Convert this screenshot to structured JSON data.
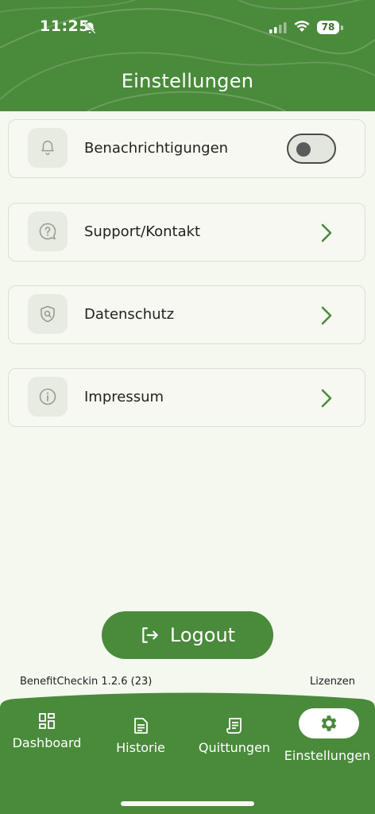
{
  "status_bar": {
    "time": "11:25",
    "battery": "78"
  },
  "header": {
    "title": "Einstellungen"
  },
  "settings": {
    "notifications": {
      "label": "Benachrichtigungen",
      "enabled": false
    },
    "support": {
      "label": "Support/Kontakt"
    },
    "privacy": {
      "label": "Datenschutz"
    },
    "imprint": {
      "label": "Impressum"
    }
  },
  "logout": {
    "label": "Logout"
  },
  "footer": {
    "version": "BenefitCheckin 1.2.6 (23)",
    "licenses": "Lizenzen"
  },
  "bottom_nav": {
    "items": [
      {
        "label": "Dashboard",
        "icon": "dashboard-icon"
      },
      {
        "label": "Historie",
        "icon": "history-icon"
      },
      {
        "label": "Quittungen",
        "icon": "receipt-icon"
      },
      {
        "label": "Einstellungen",
        "icon": "gear-icon",
        "active": true
      }
    ]
  },
  "colors": {
    "primary": "#4a8a3b",
    "background": "#f4f8ef",
    "chevron": "#4a8a3b"
  }
}
